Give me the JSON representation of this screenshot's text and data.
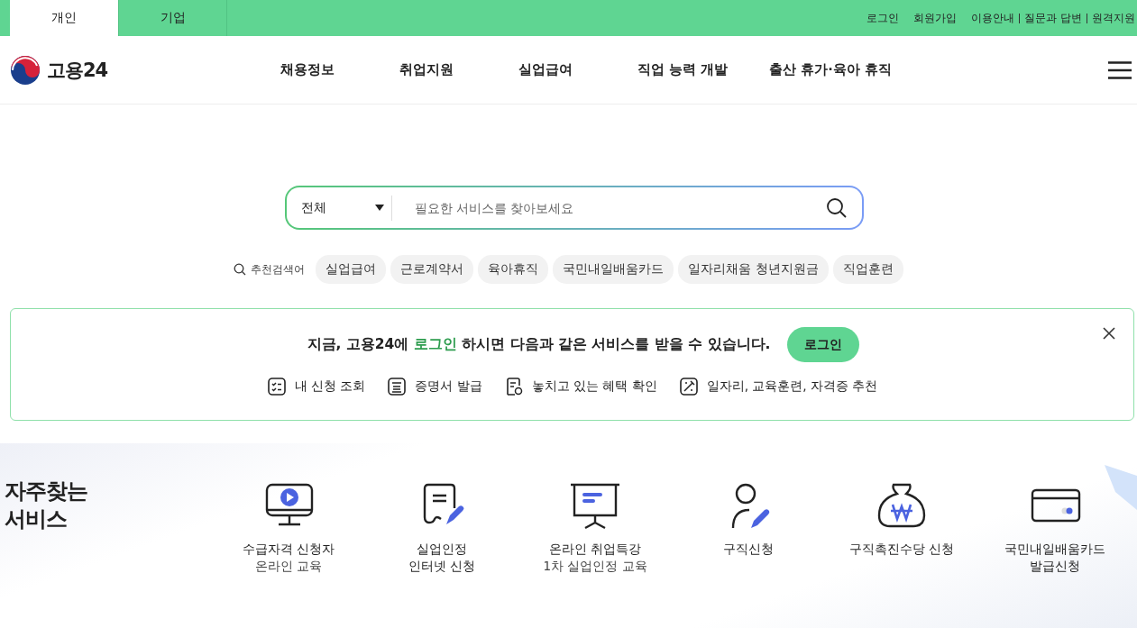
{
  "top_tabs": [
    {
      "label": "개인",
      "selected": true
    },
    {
      "label": "기업",
      "selected": false
    }
  ],
  "top_links": [
    "로그인",
    "회원가입",
    "이용안내",
    "질문과 답변",
    "원격지원"
  ],
  "logo": "고용24",
  "nav": [
    "채용정보",
    "취업지원",
    "실업급여",
    "직업 능력 개발",
    "출산 휴가·육아 휴직"
  ],
  "search": {
    "category": "전체",
    "placeholder": "필요한 서비스를 찾아보세요"
  },
  "recommended": {
    "label": "추천검색어",
    "keywords": [
      "실업급여",
      "근로계약서",
      "육아휴직",
      "국민내일배움카드",
      "일자리채움 청년지원금",
      "직업훈련"
    ]
  },
  "login_banner": {
    "before": "지금, 고용24에",
    "link": "로그인",
    "after": "하시면 다음과 같은 서비스를 받을 수 있습니다.",
    "button": "로그인",
    "features": [
      "내 신청 조회",
      "증명서 발급",
      "놓치고 있는 혜택 확인",
      "일자리, 교육훈련, 자격증 추천"
    ]
  },
  "frequent": {
    "title": "자주찾는\n서비스",
    "items": [
      {
        "title": "수급자격 신청자",
        "subtitle": "온라인 교육"
      },
      {
        "title": "실업인정\n인터넷 신청"
      },
      {
        "title": "온라인 취업특강",
        "subtitle": "1차 실업인정 교육"
      },
      {
        "title": "구직신청"
      },
      {
        "title": "구직촉진수당 신청"
      },
      {
        "title": "국민내일배움카드\n발급신청"
      }
    ]
  }
}
